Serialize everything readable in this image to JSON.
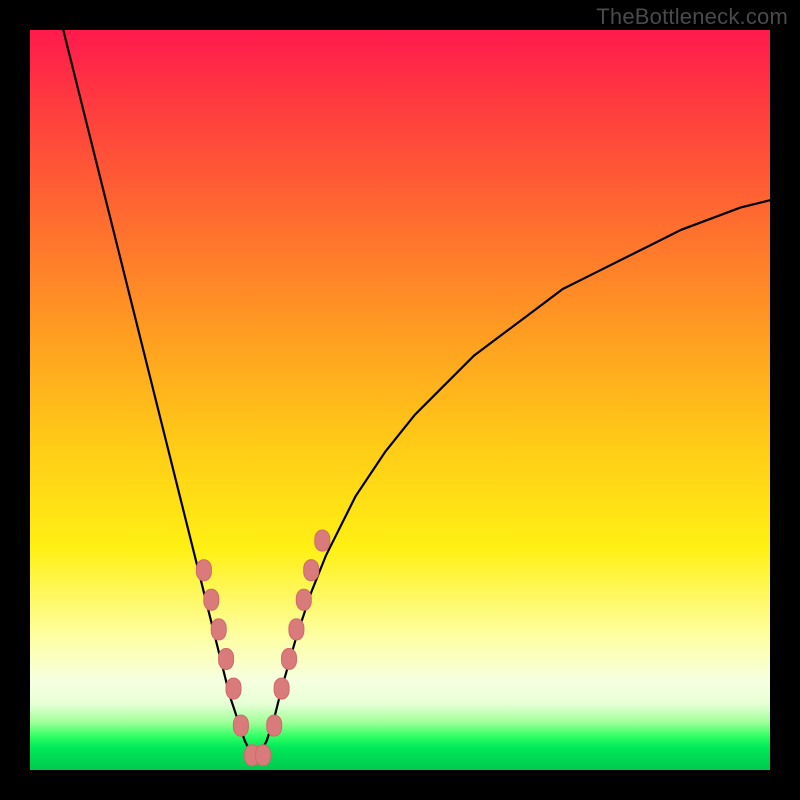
{
  "watermark": "TheBottleneck.com",
  "colors": {
    "curve_stroke": "#000000",
    "marker_fill": "#d97b7b",
    "marker_stroke": "#cf6a6a"
  },
  "chart_data": {
    "type": "line",
    "title": "",
    "xlabel": "",
    "ylabel": "",
    "xlim": [
      0,
      100
    ],
    "ylim": [
      0,
      100
    ],
    "x": [
      0,
      2,
      4,
      6,
      8,
      10,
      12,
      14,
      16,
      18,
      20,
      22,
      24,
      26,
      27,
      28,
      29,
      30,
      31,
      32,
      33,
      34,
      36,
      38,
      40,
      44,
      48,
      52,
      56,
      60,
      64,
      68,
      72,
      76,
      80,
      84,
      88,
      92,
      96,
      100
    ],
    "values": [
      120,
      111,
      102,
      94,
      86,
      78,
      70,
      62,
      54,
      46,
      38,
      30,
      22,
      14,
      10,
      7,
      4,
      2,
      2,
      4,
      7,
      11,
      18,
      24,
      29,
      37,
      43,
      48,
      52,
      56,
      59,
      62,
      65,
      67,
      69,
      71,
      73,
      74.5,
      76,
      77
    ],
    "series": [
      {
        "name": "bottleneck-curve",
        "x_ref": "x",
        "y_ref": "values"
      }
    ],
    "markers": {
      "name": "highlight-points",
      "x": [
        23.5,
        24.5,
        25.5,
        26.5,
        27.5,
        28.5,
        30.0,
        31.5,
        33.0,
        34.0,
        35.0,
        36.0,
        37.0,
        38.0,
        39.5
      ],
      "values": [
        27,
        23,
        19,
        15,
        11,
        6,
        2,
        2,
        6,
        11,
        15,
        19,
        23,
        27,
        31
      ]
    }
  }
}
